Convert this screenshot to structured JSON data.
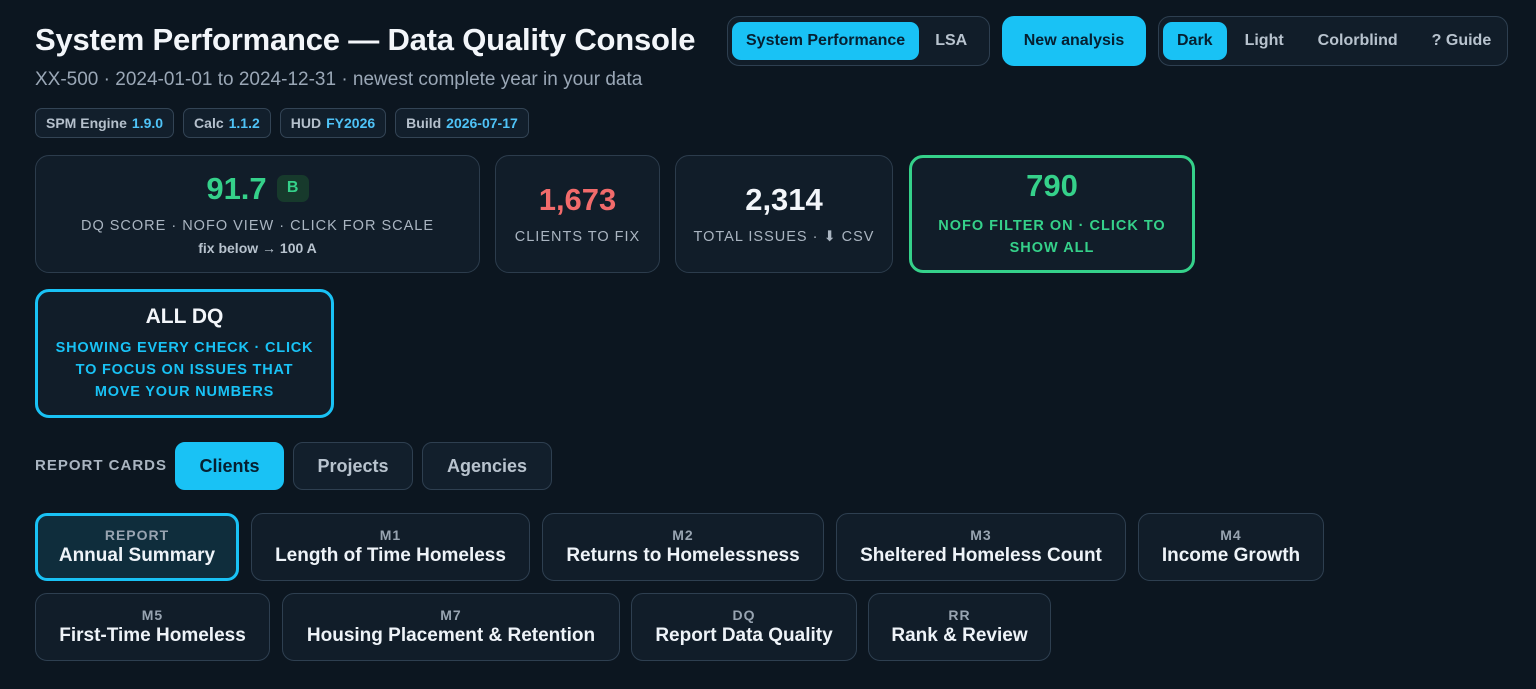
{
  "header": {
    "title": "System Performance — Data Quality Console",
    "subtitle": "XX-500 · 2024-01-01 to 2024-12-31 · newest complete year in your data"
  },
  "badges": [
    {
      "label": "SPM Engine",
      "value": "1.9.0"
    },
    {
      "label": "Calc",
      "value": "1.1.2"
    },
    {
      "label": "HUD",
      "value": "FY2026"
    },
    {
      "label": "Build",
      "value": "2026-07-17"
    }
  ],
  "mode_toggle": {
    "options": [
      "System Performance",
      "LSA"
    ],
    "active": "System Performance"
  },
  "new_analysis_label": "New analysis",
  "theme_toggle": {
    "options": [
      "Dark",
      "Light",
      "Colorblind",
      "? Guide"
    ],
    "active": "Dark"
  },
  "stats": {
    "dq": {
      "value": "91.7",
      "grade": "B",
      "label": "DQ SCORE · NOFO VIEW · CLICK FOR SCALE",
      "sub": "fix below → 100 A"
    },
    "fix": {
      "value": "1,673",
      "label": "CLIENTS TO FIX"
    },
    "issues": {
      "value": "2,314",
      "label": "TOTAL ISSUES · ⬇ CSV"
    },
    "nofo": {
      "value": "790",
      "label": "NOFO FILTER ON · CLICK TO SHOW ALL"
    },
    "all": {
      "title": "ALL DQ",
      "text": "SHOWING EVERY CHECK · CLICK TO FOCUS ON ISSUES THAT MOVE YOUR NUMBERS"
    }
  },
  "report_cards": {
    "label": "REPORT CARDS",
    "tabs": [
      "Clients",
      "Projects",
      "Agencies"
    ],
    "active_tab": "Clients"
  },
  "reports": [
    {
      "code": "REPORT",
      "name": "Annual Summary"
    },
    {
      "code": "M1",
      "name": "Length of Time Homeless"
    },
    {
      "code": "M2",
      "name": "Returns to Homelessness"
    },
    {
      "code": "M3",
      "name": "Sheltered Homeless Count"
    },
    {
      "code": "M4",
      "name": "Income Growth"
    },
    {
      "code": "M5",
      "name": "First-Time Homeless"
    },
    {
      "code": "M7",
      "name": "Housing Placement & Retention"
    },
    {
      "code": "DQ",
      "name": "Report Data Quality"
    },
    {
      "code": "RR",
      "name": "Rank & Review"
    }
  ],
  "colors": {
    "background": "#0c1620",
    "accent": "#19c2f5",
    "good": "#35d18a",
    "bad": "#f26b6b"
  }
}
